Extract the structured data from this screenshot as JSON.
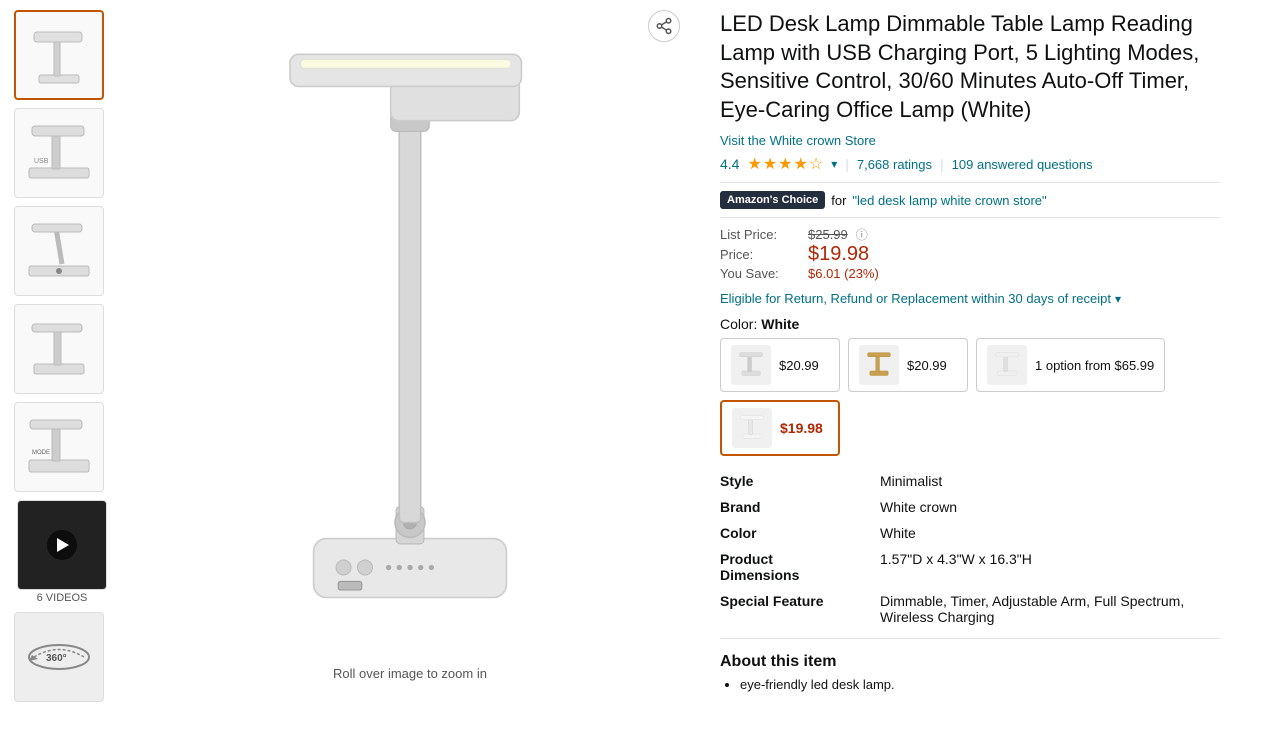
{
  "thumbnails": [
    {
      "id": "thumb-1",
      "label": "",
      "type": "image",
      "selected": true
    },
    {
      "id": "thumb-2",
      "label": "",
      "type": "image",
      "selected": false
    },
    {
      "id": "thumb-3",
      "label": "",
      "type": "image",
      "selected": false
    },
    {
      "id": "thumb-4",
      "label": "",
      "type": "image",
      "selected": false
    },
    {
      "id": "thumb-5",
      "label": "",
      "type": "image",
      "selected": false
    },
    {
      "id": "thumb-6",
      "label": "6 VIDEOS",
      "type": "video",
      "selected": false
    },
    {
      "id": "thumb-7",
      "label": "",
      "type": "360",
      "selected": false
    }
  ],
  "main_image_caption": "Roll over image to zoom in",
  "product": {
    "title": "LED Desk Lamp Dimmable Table Lamp Reading Lamp with USB Charging Port, 5 Lighting Modes, Sensitive Control, 30/60 Minutes Auto-Off Timer, Eye-Caring Office Lamp (White)",
    "store_link": "Visit the White crown Store",
    "rating": "4.4",
    "ratings_count": "7,668 ratings",
    "answered_questions": "109 answered questions",
    "amazon_choice_label": "Amazon's Choice",
    "amazon_choice_for": "for ",
    "amazon_choice_keyword": "\"led desk lamp white crown store\"",
    "list_price_label": "List Price:",
    "list_price": "$25.99",
    "price_label": "Price:",
    "price": "$19.98",
    "save_label": "You Save:",
    "save": "$6.01 (23%)",
    "return_text": "Eligible for Return, Refund or Replacement within 30 days of receipt",
    "color_label": "Color:",
    "color_value": "White",
    "color_options": [
      {
        "price": "$20.99",
        "type": "normal",
        "selected": false
      },
      {
        "price": "$20.99",
        "type": "normal",
        "selected": false
      },
      {
        "price": "1 option from $65.99",
        "type": "option",
        "selected": false
      },
      {
        "price": "$19.98",
        "type": "special",
        "selected": true
      }
    ],
    "specs": [
      {
        "label": "Style",
        "value": "Minimalist"
      },
      {
        "label": "Brand",
        "value": "White crown"
      },
      {
        "label": "Color",
        "value": "White"
      },
      {
        "label": "Product Dimensions",
        "value": "1.57\"D x 4.3\"W x 16.3\"H"
      },
      {
        "label": "Special Feature",
        "value": "Dimmable, Timer, Adjustable Arm, Full Spectrum, Wireless Charging"
      }
    ],
    "about_title": "About this item",
    "about_items": [
      "eye-friendly led desk lamp."
    ]
  }
}
